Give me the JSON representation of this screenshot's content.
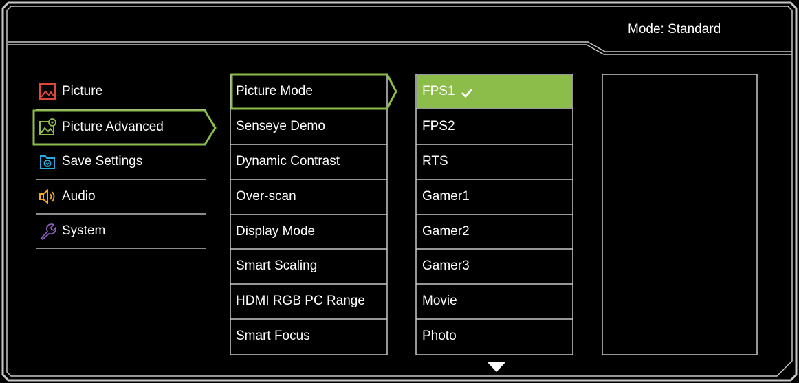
{
  "header": {
    "mode_label": "Mode: Standard"
  },
  "colors": {
    "accent": "#8cbc4a",
    "line": "#c8c8c8",
    "background": "#000000",
    "picture_icon": "#e0473b",
    "save_icon": "#29a9df",
    "audio_icon": "#f5a623",
    "system_icon": "#8b5fbf"
  },
  "categories": [
    {
      "label": "Picture",
      "icon": "picture-icon"
    },
    {
      "label": "Picture Advanced",
      "icon": "picture-advanced-icon",
      "selected": true
    },
    {
      "label": "Save Settings",
      "icon": "save-settings-icon"
    },
    {
      "label": "Audio",
      "icon": "speaker-icon"
    },
    {
      "label": "System",
      "icon": "wrench-icon"
    }
  ],
  "submenu": [
    {
      "label": "Picture Mode",
      "selected": true
    },
    {
      "label": "Senseye Demo"
    },
    {
      "label": "Dynamic Contrast"
    },
    {
      "label": "Over-scan"
    },
    {
      "label": "Display Mode"
    },
    {
      "label": "Smart Scaling"
    },
    {
      "label": "HDMI RGB PC Range"
    },
    {
      "label": "Smart Focus"
    }
  ],
  "options": [
    {
      "label": "FPS1",
      "selected": true,
      "checked": true
    },
    {
      "label": "FPS2"
    },
    {
      "label": "RTS"
    },
    {
      "label": "Gamer1"
    },
    {
      "label": "Gamer2"
    },
    {
      "label": "Gamer3"
    },
    {
      "label": "Movie"
    },
    {
      "label": "Photo"
    }
  ],
  "scroll": {
    "icon": "scroll-down-arrow-icon"
  }
}
